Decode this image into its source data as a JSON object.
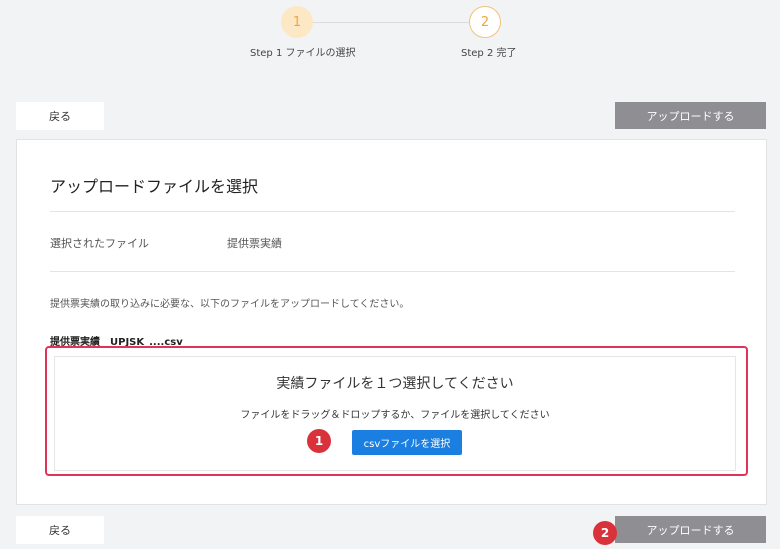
{
  "stepper": {
    "steps": [
      {
        "number": "1",
        "label": "Step 1 ファイルの選択"
      },
      {
        "number": "2",
        "label": "Step 2 完了"
      }
    ]
  },
  "actions": {
    "back_label": "戻る",
    "upload_label": "アップロードする"
  },
  "card": {
    "title": "アップロードファイルを選択",
    "selected_file_label": "選択されたファイル",
    "selected_file_value": "提供票実績",
    "instruction": "提供票実績の取り込みに必要な、以下のファイルをアップロードしてください。",
    "required_file": "提供票実績　UPJSK_....csv"
  },
  "dropzone": {
    "title": "実績ファイルを１つ選択してください",
    "subtitle": "ファイルをドラッグ＆ドロップするか、ファイルを選択してください",
    "button_label": "csvファイルを選択"
  },
  "annotations": {
    "badge1": "1",
    "badge2": "2",
    "highlight_color": "#e0335a",
    "badge_color": "#d9323a"
  },
  "colors": {
    "step_active_bg": "#fde8c6",
    "step_number": "#f0a63a",
    "primary_button": "#1a7fe0",
    "disabled_button": "#8e8e93"
  }
}
